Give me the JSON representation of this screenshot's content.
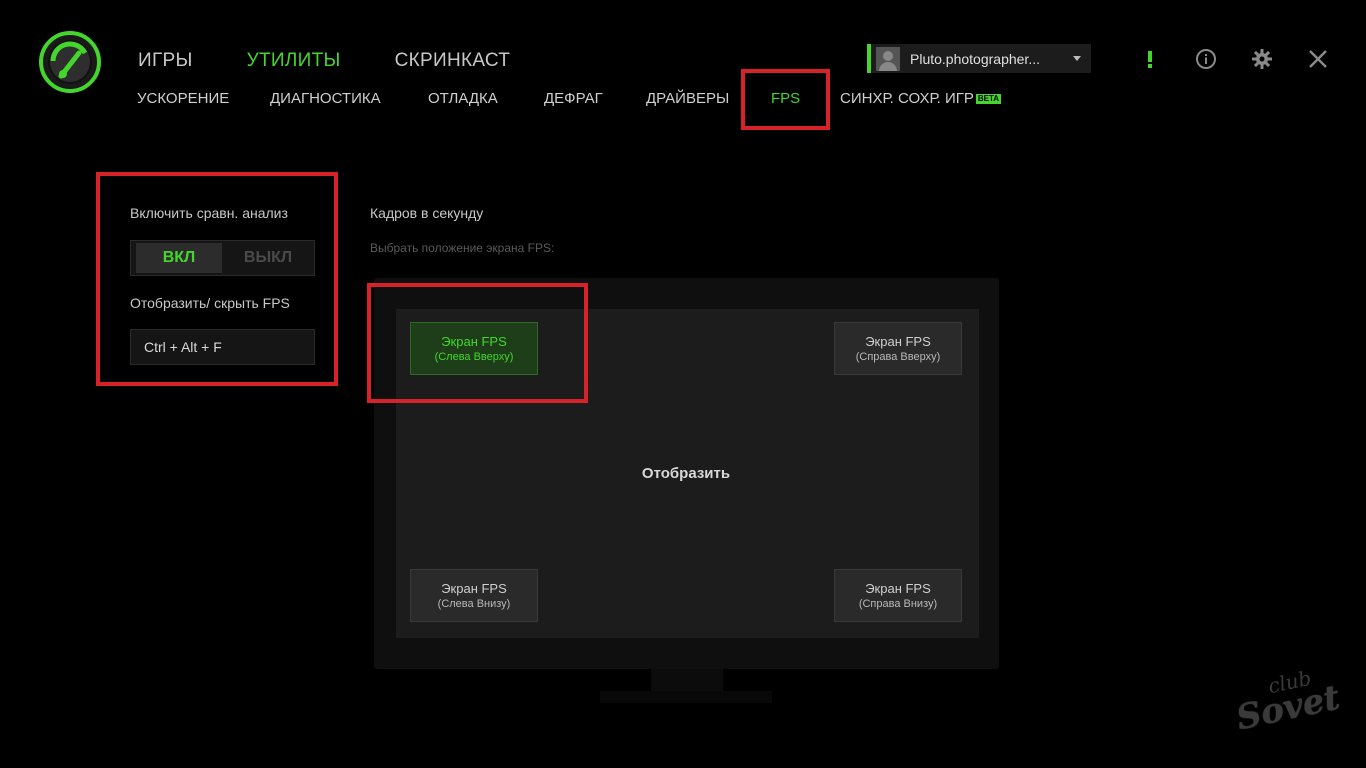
{
  "colors": {
    "accent": "#44d62c",
    "annotation": "#d8222a",
    "background": "#000000",
    "panel": "#1c1c1c"
  },
  "logo": {
    "icon": "speedometer-logo-icon"
  },
  "main_nav": [
    {
      "label": "ИГРЫ",
      "active": false
    },
    {
      "label": "УТИЛИТЫ",
      "active": true
    },
    {
      "label": "СКРИНКАСТ",
      "active": false
    }
  ],
  "sub_nav": [
    {
      "label": "УСКОРЕНИЕ",
      "active": false
    },
    {
      "label": "ДИАГНОСТИКА",
      "active": false
    },
    {
      "label": "ОТЛАДКА",
      "active": false
    },
    {
      "label": "ДЕФРАГ",
      "active": false
    },
    {
      "label": "ДРАЙВЕРЫ",
      "active": false
    },
    {
      "label": "FPS",
      "active": true
    },
    {
      "label": "СИНХР. СОХР. ИГР",
      "badge": "BETA",
      "active": false
    }
  ],
  "user": {
    "name": "Pluto.photographer...",
    "avatar_icon": "user-avatar-icon",
    "dropdown_icon": "chevron-down-icon"
  },
  "window_icons": [
    "alert-icon",
    "info-icon",
    "gear-icon",
    "close-icon"
  ],
  "left_panel": {
    "benchmark_label": "Включить сравн. анализ",
    "toggle_on": "ВКЛ",
    "toggle_off": "ВЫКЛ",
    "toggle_state": "on",
    "show_hide_label": "Отобразить/ скрыть FPS",
    "hotkey": "Ctrl + Alt + F"
  },
  "fps_panel": {
    "title": "Кадров в секунду",
    "hint": "Выбрать положение экрана FPS:",
    "display_label": "Отобразить",
    "positions": [
      {
        "title": "Экран FPS",
        "subtitle": "(Слева Вверху)",
        "active": true
      },
      {
        "title": "Экран FPS",
        "subtitle": "(Справа Вверху)",
        "active": false
      },
      {
        "title": "Экран FPS",
        "subtitle": "(Слева Внизу)",
        "active": false
      },
      {
        "title": "Экран FPS",
        "subtitle": "(Справа Внизу)",
        "active": false
      }
    ]
  },
  "watermark": {
    "line1": "club",
    "line2": "Sovet"
  }
}
